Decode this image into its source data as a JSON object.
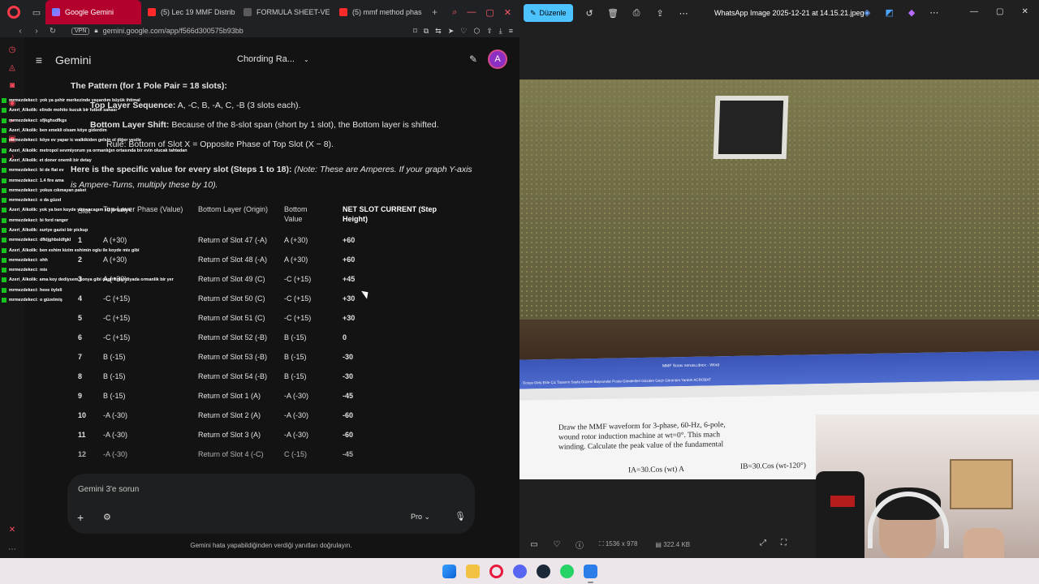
{
  "browser": {
    "tabs": [
      {
        "label": "Google Gemini",
        "active": true
      },
      {
        "label": "(5) Lec 19 MMF Distrib",
        "active": false
      },
      {
        "label": "FORMULA SHEET-VE",
        "active": false
      },
      {
        "label": "(5) mmf method phas",
        "active": false
      }
    ],
    "vpn_label": "VPN",
    "url": "gemini.google.com/app/f566d300575b93bb",
    "accent_color": "#b3002d"
  },
  "gemini": {
    "brand": "Gemini",
    "conversation_title": "Chording Ra...",
    "avatar_letter": "A",
    "heading_pattern": "The Pattern (for 1 Pole Pair = 18 slots):",
    "bullet1_label": "Top Layer Sequence:",
    "bullet1_text": " A, -C, B, -A, C, -B (3 slots each).",
    "bullet2_label": "Bottom Layer Shift:",
    "bullet2_text": " Because of the 8-slot span (short by 1 slot), the Bottom layer is shifted.",
    "sub_bullet": "Rule: Bottom of Slot X = Opposite Phase of Top Slot (X − 8).",
    "para_bold": "Here is the specific value for every slot (Steps 1 to 18):",
    "para_italic": " (Note: These are Amperes. If your graph Y-axis is Ampere-Turns, multiply these by 10).",
    "table": {
      "headers": [
        "Slot",
        "Top Layer Phase (Value)",
        "Bottom Layer (Origin)",
        "Bottom Value",
        "NET SLOT CURRENT (Step Height)"
      ],
      "rows": [
        [
          "1",
          "A (+30)",
          "Return of Slot 47 (-A)",
          "A (+30)",
          "+60"
        ],
        [
          "2",
          "A (+30)",
          "Return of Slot 48 (-A)",
          "A (+30)",
          "+60"
        ],
        [
          "3",
          "A (+30)",
          "Return of Slot 49 (C)",
          "-C (+15)",
          "+45"
        ],
        [
          "4",
          "-C (+15)",
          "Return of Slot 50 (C)",
          "-C (+15)",
          "+30"
        ],
        [
          "5",
          "-C (+15)",
          "Return of Slot 51 (C)",
          "-C (+15)",
          "+30"
        ],
        [
          "6",
          "-C (+15)",
          "Return of Slot 52 (-B)",
          "B (-15)",
          "0"
        ],
        [
          "7",
          "B (-15)",
          "Return of Slot 53 (-B)",
          "B (-15)",
          "-30"
        ],
        [
          "8",
          "B (-15)",
          "Return of Slot 54 (-B)",
          "B (-15)",
          "-30"
        ],
        [
          "9",
          "B (-15)",
          "Return of Slot 1 (A)",
          "-A (-30)",
          "-45"
        ],
        [
          "10",
          "-A (-30)",
          "Return of Slot 2 (A)",
          "-A (-30)",
          "-60"
        ],
        [
          "11",
          "-A (-30)",
          "Return of Slot 3 (A)",
          "-A (-30)",
          "-60"
        ],
        [
          "12",
          "-A (-30)",
          "Return of Slot 4 (-C)",
          "C (-15)",
          "-45"
        ]
      ]
    },
    "prompt_placeholder": "Gemini 3'e sorun",
    "model_label": "Pro",
    "disclaimer": "Gemini hata yapabildiğinden verdiği yanıtları doğrulayın."
  },
  "chat_overlay": [
    {
      "user": "mrmezdekeci:",
      "msg": "yok ya şehir merkezinde yaşardım büyük ihtimal"
    },
    {
      "user": "Azeri_Alkolik:",
      "msg": "elinde mohito kucuk bir futbol sahası"
    },
    {
      "user": "mrmezdekeci:",
      "msg": "sfjkghsdfkgs"
    },
    {
      "user": "Azeri_Alkolik:",
      "msg": "ben emekli olsam köye giderdim"
    },
    {
      "user": "mrmezdekeci:",
      "msg": "köye ev yapar ic walkikiden gelsin ol diğer vesile"
    },
    {
      "user": "Azeri_Alkolik:",
      "msg": "metropol sevmiyorum ya ormanlığın ortasında bir evin olucak tahtadan"
    },
    {
      "user": "Azeri_Alkolik:",
      "msg": "et doner onemli bir detay"
    },
    {
      "user": "mrmezdekeci:",
      "msg": "bi de flat ev"
    },
    {
      "user": "mrmezdekeci:",
      "msg": "1.4 fire ama"
    },
    {
      "user": "mrmezdekeci:",
      "msg": "yokus cıkmayan paket"
    },
    {
      "user": "mrmezdekeci:",
      "msg": "o da güzel"
    },
    {
      "user": "Azeri_Alkolik:",
      "msg": "yok ya ben koyde yasıyacagım siz avrupaya"
    },
    {
      "user": "mrmezdekeci:",
      "msg": "bi ford ranger"
    },
    {
      "user": "Azeri_Alkolik:",
      "msg": "suriye gazisi bir pickup"
    },
    {
      "user": "mrmezdekeci:",
      "msg": "dfkljghbsldfgkl"
    },
    {
      "user": "Azeri_Alkolik:",
      "msg": "ben eshim kizim eshimin oglu ile koyde mis gibi"
    },
    {
      "user": "mrmezdekeci:",
      "msg": "ohh"
    },
    {
      "user": "mrmezdekeci:",
      "msg": "mis"
    },
    {
      "user": "Azeri_Alkolik:",
      "msg": "ama koy dediysem konya gibi degil finlandiyada ormanlik bir yer"
    },
    {
      "user": "mrmezdekeci:",
      "msg": "heee öyleli"
    },
    {
      "user": "mrmezdekeci:",
      "msg": "o güzelmiş"
    }
  ],
  "viewer": {
    "edit_label": "Düzenle",
    "file_name": "WhatsApp Image 2025-12-21 at 14.15.21.jpeg",
    "dimensions": "1536 x 978",
    "file_size": "322.4 KB",
    "accent_color": "#4cc2ff",
    "photo_doc_title": "MMF Sınav sorusu.docx - Word",
    "photo_doc_menu": "Dosya  Giriş  Ekle  Çiz  Tasarım  Sayfa Düzeni  Başvurular  Posta Gönderileri  Gözden Geçir  Görünüm  Yardım  ACROBAT",
    "photo_doc_line1": "Draw the MMF waveform for 3-phase, 60-Hz, 6-pole,",
    "photo_doc_line2": "wound rotor induction machine at wt=0°. This mach",
    "photo_doc_line3": "winding. Calculate the peak value of the fundamental",
    "photo_doc_line4a": "I",
    "photo_doc_eqA": "A=30.Cos (wt) A",
    "photo_doc_eqB": "B=30.Cos (wt-120°)",
    "photo_doc_subA": "IA=30.Cos (wt) A",
    "photo_doc_subB": "IB=30.Cos (wt-120°)"
  }
}
